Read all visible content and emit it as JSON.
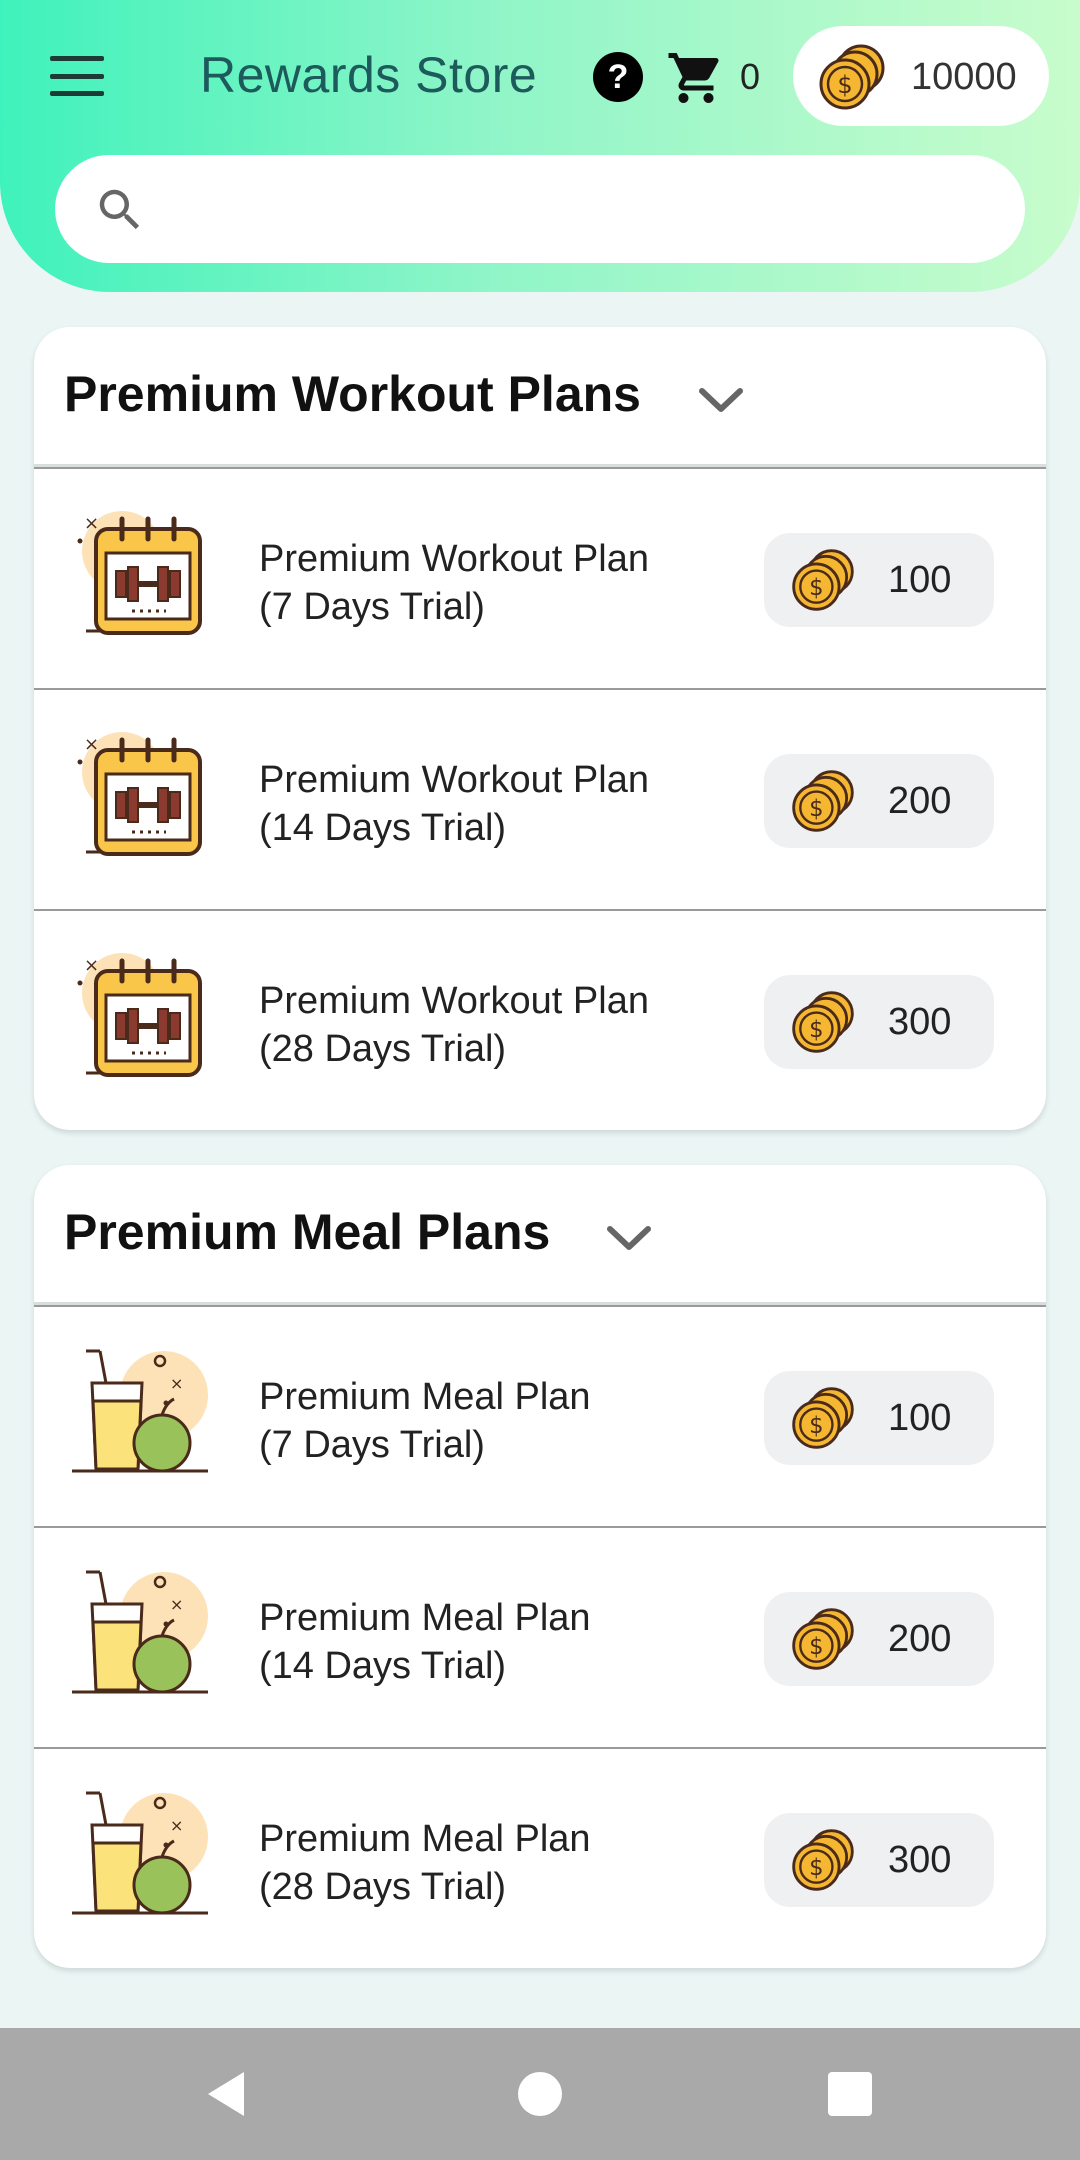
{
  "header": {
    "title": "Rewards Store",
    "cart_count": "0",
    "coin_balance": "10000",
    "icons": [
      "menu-icon",
      "help-icon",
      "cart-icon",
      "coins-icon",
      "search-icon"
    ]
  },
  "search": {
    "value": "",
    "placeholder": ""
  },
  "sections": [
    {
      "title": "Premium Workout Plans",
      "icon": "workout-calendar-icon",
      "items": [
        {
          "line1": "Premium Workout Plan",
          "line2": "(7 Days Trial)",
          "price": "100"
        },
        {
          "line1": "Premium Workout Plan",
          "line2": "(14 Days Trial)",
          "price": "200"
        },
        {
          "line1": "Premium Workout Plan",
          "line2": "(28 Days Trial)",
          "price": "300"
        }
      ]
    },
    {
      "title": "Premium Meal Plans",
      "icon": "meal-juice-apple-icon",
      "items": [
        {
          "line1": "Premium Meal Plan",
          "line2": "(7 Days Trial)",
          "price": "100"
        },
        {
          "line1": "Premium Meal Plan",
          "line2": "(14 Days Trial)",
          "price": "200"
        },
        {
          "line1": "Premium Meal Plan",
          "line2": "(28 Days Trial)",
          "price": "300"
        }
      ]
    }
  ],
  "navbar": {
    "icons": [
      "back-icon",
      "home-icon",
      "recents-icon"
    ]
  },
  "colors": {
    "header_gradient_start": "#3ff2bb",
    "header_gradient_end": "#c8fccc",
    "title_color": "#1d5a5c",
    "coin_gold": "#f5b731",
    "navbar": "#a9a9a9"
  }
}
